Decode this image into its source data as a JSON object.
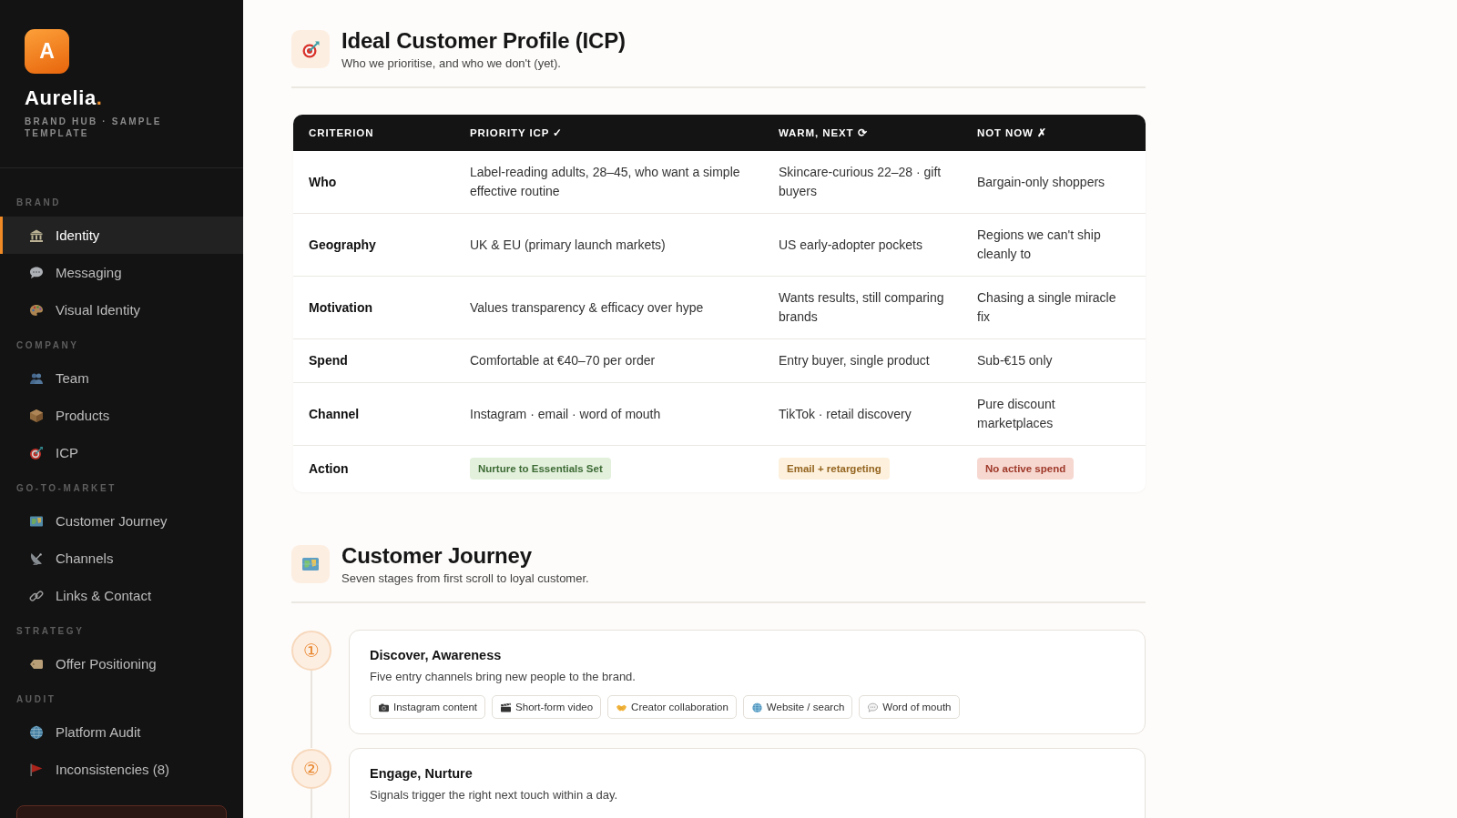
{
  "sidebar": {
    "logo": "A",
    "brand": {
      "name": "Aurelia",
      "accent": "."
    },
    "tagline": "BRAND HUB · SAMPLE TEMPLATE",
    "sections": [
      {
        "label": "BRAND",
        "items": [
          {
            "label": "Identity",
            "selected": true
          },
          {
            "label": "Messaging",
            "selected": false
          },
          {
            "label": "Visual Identity",
            "selected": false
          }
        ]
      },
      {
        "label": "COMPANY",
        "items": [
          {
            "label": "Team",
            "selected": false
          },
          {
            "label": "Products",
            "selected": false
          },
          {
            "label": "ICP",
            "selected": false
          }
        ]
      },
      {
        "label": "GO-TO-MARKET",
        "items": [
          {
            "label": "Customer Journey",
            "selected": false
          },
          {
            "label": "Channels",
            "selected": false
          },
          {
            "label": "Links & Contact",
            "selected": false
          }
        ]
      },
      {
        "label": "STRATEGY",
        "items": [
          {
            "label": "Offer Positioning",
            "selected": false
          }
        ]
      },
      {
        "label": "AUDIT",
        "items": [
          {
            "label": "Platform Audit",
            "selected": false
          },
          {
            "label": "Inconsistencies (8)",
            "selected": false
          }
        ]
      }
    ]
  },
  "icp": {
    "title": "Ideal Customer Profile (ICP)",
    "subtitle": "Who we prioritise, and who we don't (yet).",
    "table": {
      "columns": [
        "CRITERION",
        "PRIORITY ICP ✓",
        "WARM, NEXT ⟳",
        "NOT NOW ✗"
      ],
      "rows": [
        {
          "kind": "text",
          "cells": [
            "Who",
            "Label-reading adults, 28–45, who want a simple effective routine",
            "Skincare-curious 22–28 · gift buyers",
            "Bargain-only shoppers"
          ]
        },
        {
          "kind": "text",
          "cells": [
            "Geography",
            "UK & EU (primary launch markets)",
            "US early-adopter pockets",
            "Regions we can't ship cleanly to"
          ]
        },
        {
          "kind": "text",
          "cells": [
            "Motivation",
            "Values transparency & efficacy over hype",
            "Wants results, still comparing brands",
            "Chasing a single miracle fix"
          ]
        },
        {
          "kind": "text",
          "cells": [
            "Spend",
            "Comfortable at €40–70 per order",
            "Entry buyer, single product",
            "Sub-€15 only"
          ]
        },
        {
          "kind": "text",
          "cells": [
            "Channel",
            "Instagram · email · word of mouth",
            "TikTok · retail discovery",
            "Pure discount marketplaces"
          ]
        },
        {
          "kind": "tags",
          "cells": [
            {
              "text": "Action",
              "kind": "label"
            },
            {
              "text": "Nurture to Essentials Set",
              "kind": "positive"
            },
            {
              "text": "Email + retargeting",
              "kind": "caution"
            },
            {
              "text": "No active spend",
              "kind": "negative"
            }
          ]
        }
      ]
    }
  },
  "journey": {
    "title": "Customer Journey",
    "subtitle": "Seven stages from first scroll to loyal customer.",
    "stages": [
      {
        "number": "①",
        "title": "Discover, Awareness",
        "description": "Five entry channels bring new people to the brand.",
        "tags": [
          "Instagram content",
          "Short-form video",
          "Creator collaboration",
          "Website / search",
          "Word of mouth"
        ]
      },
      {
        "number": "②",
        "title": "Engage, Nurture",
        "description": "Signals trigger the right next touch within a day."
      }
    ]
  }
}
